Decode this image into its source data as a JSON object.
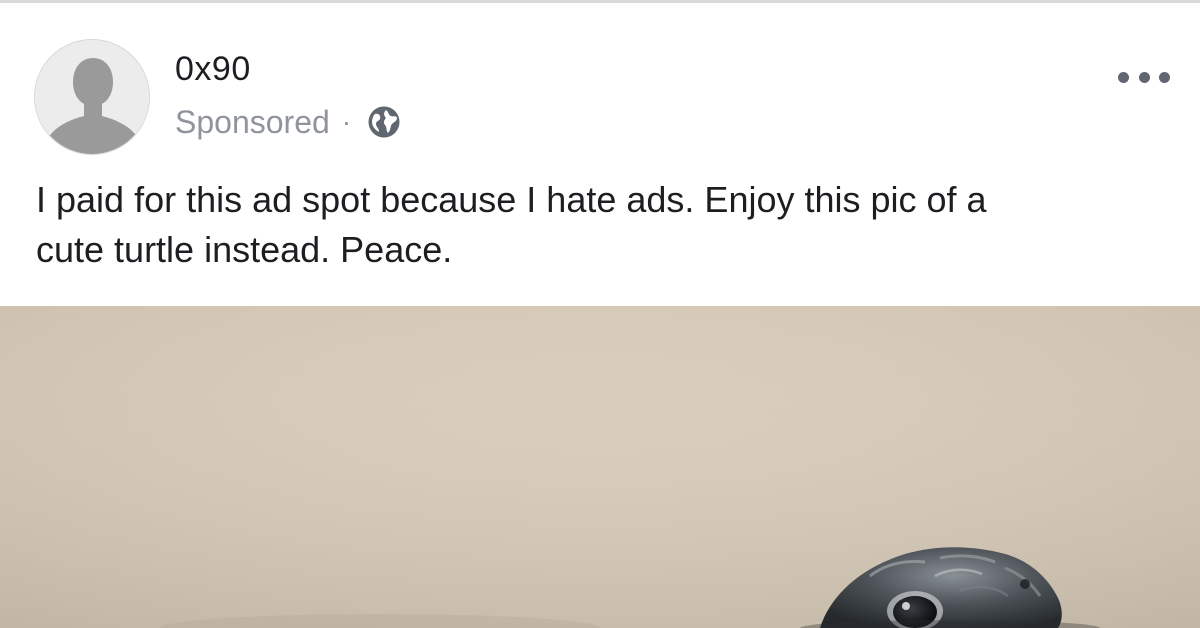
{
  "post": {
    "author": {
      "name": "0x90",
      "avatar_icon": "default-profile-silhouette-icon"
    },
    "meta": {
      "sponsored_label": "Sponsored",
      "separator": "·",
      "audience_icon": "globe-icon"
    },
    "more_options_icon": "more-options-icon",
    "message_line_1": "I paid for this ad spot because I hate ads. Enjoy this pic of a",
    "message_line_2": "cute turtle instead. Peace.",
    "image": {
      "subject_icon": "turtle-photo"
    }
  },
  "colors": {
    "text_primary": "#1c1e21",
    "text_secondary": "#90949c",
    "photo_background": "#d8cbb8"
  }
}
